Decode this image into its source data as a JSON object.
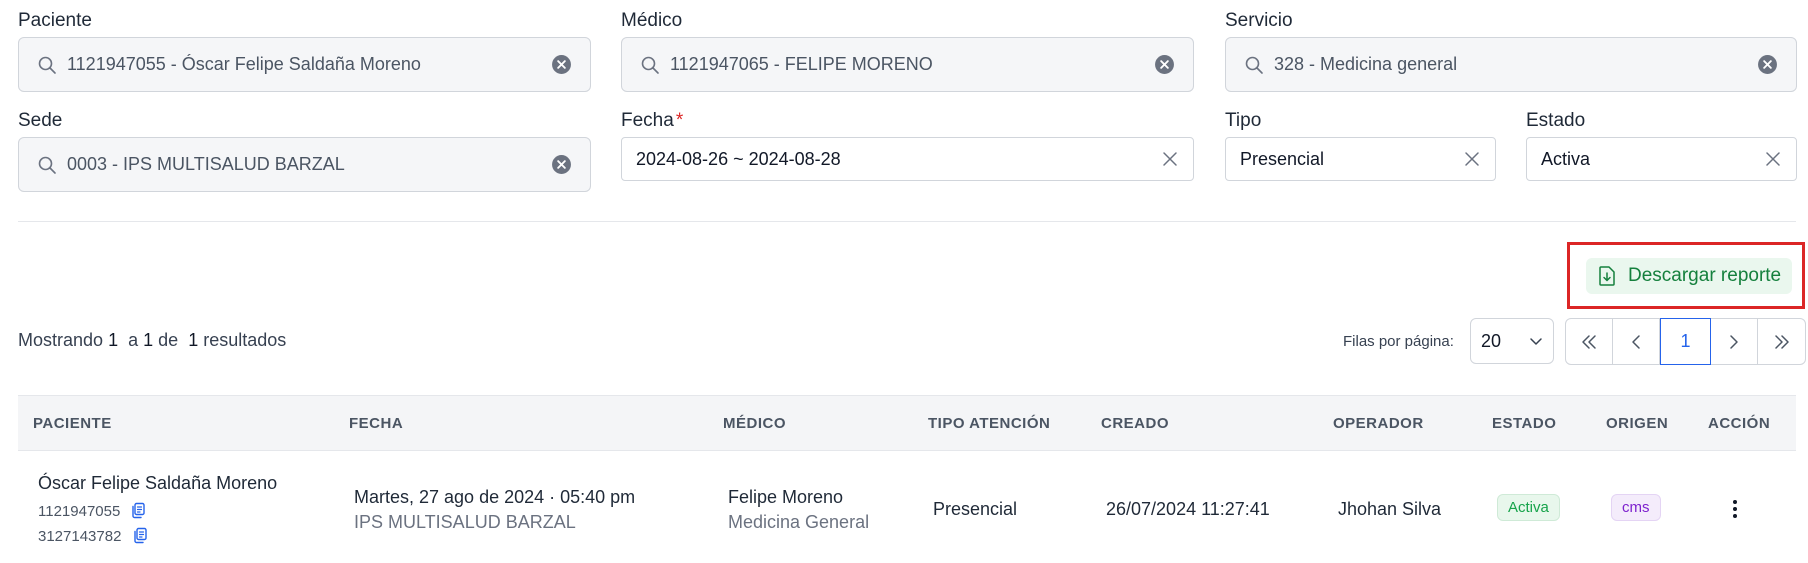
{
  "filters": {
    "paciente": {
      "label": "Paciente",
      "value": "1121947055  -  Óscar Felipe Saldaña Moreno"
    },
    "medico": {
      "label": "Médico",
      "value": "1121947065  -  FELIPE MORENO"
    },
    "servicio": {
      "label": "Servicio",
      "value": "328  -  Medicina general"
    },
    "sede": {
      "label": "Sede",
      "value": "0003  -  IPS MULTISALUD BARZAL"
    },
    "fecha": {
      "label": "Fecha",
      "required_mark": "*",
      "value": "2024-08-26 ~ 2024-08-28"
    },
    "tipo": {
      "label": "Tipo",
      "value": "Presencial"
    },
    "estado": {
      "label": "Estado",
      "value": "Activa"
    }
  },
  "actions": {
    "download_label": "Descargar reporte"
  },
  "results": {
    "prefix": "Mostrando",
    "from": "1",
    "to_word": "a",
    "to": "1",
    "of_word": "de",
    "total": "1",
    "suffix": "resultados"
  },
  "pagination": {
    "rows_label": "Filas por página:",
    "rows_value": "20",
    "current_page": "1"
  },
  "table": {
    "headers": [
      "PACIENTE",
      "FECHA",
      "MÉDICO",
      "TIPO ATENCIÓN",
      "CREADO",
      "OPERADOR",
      "ESTADO",
      "ORIGEN",
      "ACCIÓN"
    ],
    "rows": [
      {
        "patient_name": "Óscar Felipe Saldaña Moreno",
        "patient_id": "1121947055",
        "patient_phone": "3127143782",
        "date": "Martes, 27 ago de 2024 · 05:40 pm",
        "site": "IPS MULTISALUD BARZAL",
        "doctor": "Felipe Moreno",
        "specialty": "Medicina General",
        "attention_type": "Presencial",
        "created": "26/07/2024 11:27:41",
        "operator": "Jhohan Silva",
        "status": "Activa",
        "origin": "cms"
      }
    ]
  },
  "colors": {
    "accent": "#2563eb",
    "success": "#16a34a",
    "highlight": "#dc2626",
    "origin": "#7e22ce"
  }
}
